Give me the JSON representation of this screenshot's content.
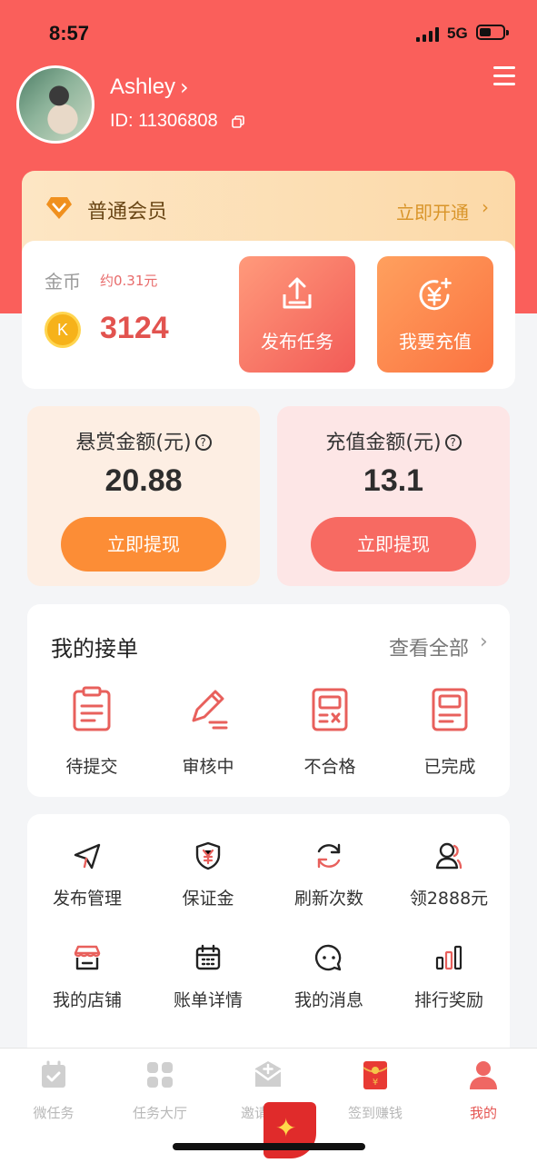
{
  "status_bar": {
    "time": "8:57",
    "network": "5G"
  },
  "profile": {
    "username": "Ashley",
    "id_text": "ID: 11306808"
  },
  "vip": {
    "label": "普通会员",
    "action": "立即开通"
  },
  "coins": {
    "label": "金币",
    "approx": "约0.31元",
    "value": "3124",
    "coin_letter": "K"
  },
  "actions": {
    "publish": "发布任务",
    "recharge": "我要充值"
  },
  "balances": {
    "reward": {
      "title": "悬赏金额(元)",
      "value": "20.88",
      "button": "立即提现"
    },
    "recharge": {
      "title": "充值金额(元)",
      "value": "13.1",
      "button": "立即提现"
    }
  },
  "orders": {
    "title": "我的接单",
    "view_all": "查看全部",
    "items": [
      {
        "label": "待提交",
        "icon": "clipboard-icon"
      },
      {
        "label": "审核中",
        "icon": "pencil-icon"
      },
      {
        "label": "不合格",
        "icon": "rejected-doc-icon"
      },
      {
        "label": "已完成",
        "icon": "completed-doc-icon"
      }
    ]
  },
  "tools": [
    {
      "label": "发布管理",
      "icon": "paper-plane-icon"
    },
    {
      "label": "保证金",
      "icon": "shield-yen-icon"
    },
    {
      "label": "刷新次数",
      "icon": "refresh-icon"
    },
    {
      "label": "领2888元",
      "icon": "user-icon"
    },
    {
      "label": "我的店铺",
      "icon": "shop-icon"
    },
    {
      "label": "账单详情",
      "icon": "calendar-icon"
    },
    {
      "label": "我的消息",
      "icon": "message-icon"
    },
    {
      "label": "排行奖励",
      "icon": "ranking-bars-icon"
    }
  ],
  "tabbar": [
    {
      "label": "微任务",
      "icon": "task-icon",
      "active": false
    },
    {
      "label": "任务大厅",
      "icon": "grid-icon",
      "active": false
    },
    {
      "label": "邀请好友",
      "icon": "invite-mail-icon",
      "active": false
    },
    {
      "label": "签到赚钱",
      "icon": "red-envelope-icon",
      "active": false
    },
    {
      "label": "我的",
      "icon": "profile-icon",
      "active": true
    }
  ],
  "colors": {
    "primary": "#fa5f5b",
    "orange": "#fc8d36",
    "gold": "#d9952a"
  }
}
